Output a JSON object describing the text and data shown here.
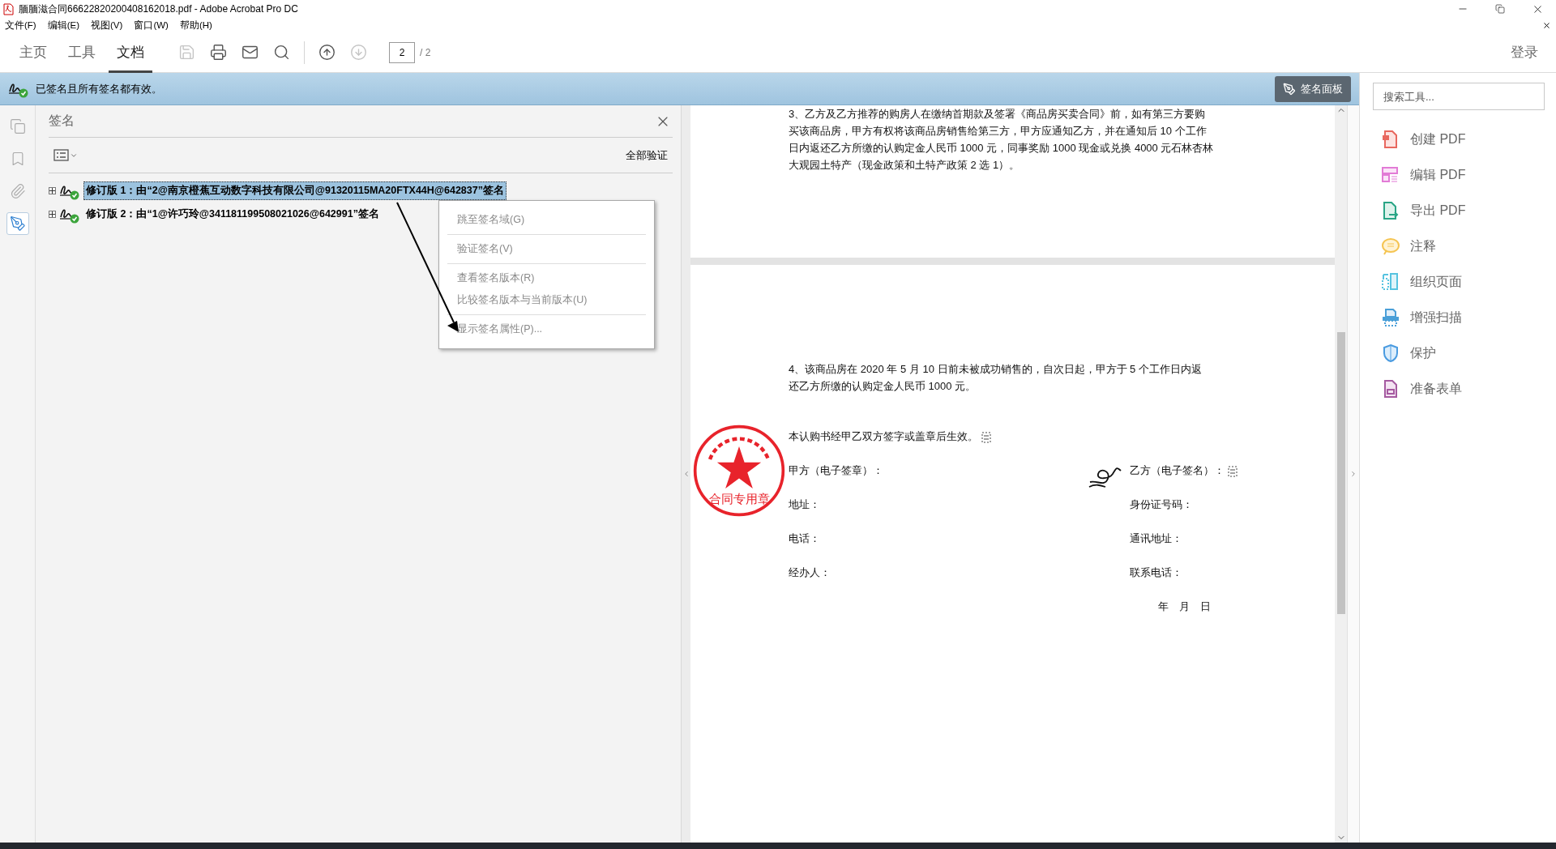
{
  "window": {
    "title": "腼腼滋合同66622820200408162018.pdf - Adobe Acrobat Pro DC"
  },
  "menu": [
    "文件(F)",
    "编辑(E)",
    "视图(V)",
    "窗口(W)",
    "帮助(H)"
  ],
  "toolbar": {
    "tabs": [
      {
        "label": "主页",
        "selected": false
      },
      {
        "label": "工具",
        "selected": false
      },
      {
        "label": "文档",
        "selected": true
      }
    ],
    "actions": [
      {
        "kind": "save",
        "disabled": true
      },
      {
        "kind": "print",
        "disabled": false
      },
      {
        "kind": "mail",
        "disabled": false
      },
      {
        "kind": "search",
        "disabled": false
      },
      {
        "kind": "prev",
        "disabled": false
      },
      {
        "kind": "next",
        "disabled": true
      }
    ],
    "page_value": "2",
    "page_total": "/ 2",
    "sign_in": "登录"
  },
  "info_bar": {
    "message": "已签名且所有签名都有效。",
    "button": "签名面板"
  },
  "left_rail": [
    {
      "kind": "pages",
      "selected": false
    },
    {
      "kind": "bookmarks",
      "selected": false
    },
    {
      "kind": "attachments",
      "selected": false
    },
    {
      "kind": "signatures",
      "selected": true
    }
  ],
  "signatures_panel": {
    "title": "签名",
    "verify_all": "全部验证",
    "items": [
      {
        "label": "修订版 1：由“2@南京橙蕉互动数字科技有限公司@91320115MA20FTX44H@642837”签名",
        "selected": true
      },
      {
        "label": "修订版 2：由“1@许巧玲@341181199508021026@642991”签名",
        "selected": false
      }
    ]
  },
  "context_menu": {
    "groups": [
      [
        {
          "label": "跳至签名域(G)",
          "disabled": true
        }
      ],
      [
        {
          "label": "验证签名(V)",
          "disabled": true
        }
      ],
      [
        {
          "label": "查看签名版本(R)",
          "disabled": true
        },
        {
          "label": "比较签名版本与当前版本(U)",
          "disabled": true
        }
      ],
      [
        {
          "label": "显示签名属性(P)...",
          "disabled": true
        }
      ]
    ]
  },
  "document": {
    "page_1_lines": [
      "3、乙方及乙方推荐的购房人在缴纳首期款及签署《商品房买卖合同》前，如有第三方要购",
      "买该商品房，甲方有权将该商品房销售给第三方，甲方应通知乙方，并在通知后 10 个工作",
      "日内返还乙方所缴的认购定金人民币 1000 元，同事奖励 1000 现金或兑换 4000 元石林杏林",
      "大观园土特产（现金政策和土特产政策 2 选 1）。"
    ],
    "page_2": {
      "paragraph_lines": [
        "4、该商品房在 2020 年 5 月 10 日前未被成功销售的，自次日起，甲方于 5 个工作日内返",
        "还乙方所缴的认购定金人民币 1000 元。"
      ],
      "effective": "本认购书经甲乙双方签字或盖章后生效。",
      "parties": [
        {
          "left": "甲方（电子签章）：",
          "right": "乙方（电子签名）："
        },
        {
          "left": "地址：",
          "right": "身份证号码："
        },
        {
          "left": "电话：",
          "right": "通讯地址："
        },
        {
          "left": "经办人：",
          "right": "联系电话："
        }
      ],
      "date": "年　月　日",
      "seal_text": "合同专用章"
    }
  },
  "tools_panel": {
    "search_placeholder": "搜索工具...",
    "tools": [
      {
        "kind": "create",
        "label": "创建 PDF"
      },
      {
        "kind": "edit",
        "label": "编辑 PDF"
      },
      {
        "kind": "export",
        "label": "导出 PDF"
      },
      {
        "kind": "comment",
        "label": "注释"
      },
      {
        "kind": "organize",
        "label": "组织页面"
      },
      {
        "kind": "scan",
        "label": "增强扫描"
      },
      {
        "kind": "protect",
        "label": "保护"
      },
      {
        "kind": "forms",
        "label": "准备表单"
      }
    ]
  }
}
